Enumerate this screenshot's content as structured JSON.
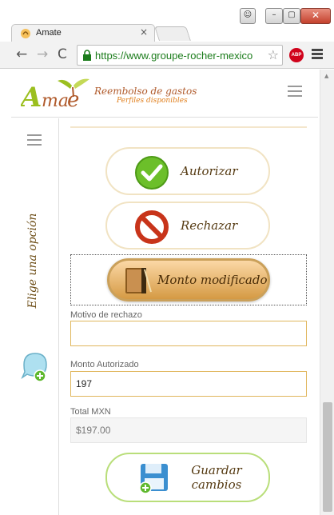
{
  "browser": {
    "tab_title": "Amate",
    "tab_close": "×",
    "url": "https://www.groupe-rocher-mexico",
    "star": "☆",
    "abp_label": "ABP",
    "nav": {
      "back": "←",
      "forward": "→",
      "reload": "C"
    }
  },
  "header": {
    "brand_title": "Reembolso de gastos",
    "brand_subtitle": "Perfiles disponibles",
    "logo_text": "Amate"
  },
  "sidebar": {
    "label": "Elige una opción"
  },
  "actions": {
    "autorizar": "Autorizar",
    "rechazar": "Rechazar",
    "monto_modificado": "Monto modificado",
    "guardar_line1": "Guardar",
    "guardar_line2": "cambios"
  },
  "form": {
    "motivo_label": "Motivo de rechazo",
    "motivo_value": "",
    "monto_label": "Monto Autorizado",
    "monto_value": "197",
    "total_label": "Total MXN",
    "total_value": "$197.00"
  },
  "colors": {
    "accent_border": "#e0b65c",
    "save_border": "#b9de7a",
    "brand_brown": "#b05a2b",
    "brand_orange": "#e07e1b"
  }
}
